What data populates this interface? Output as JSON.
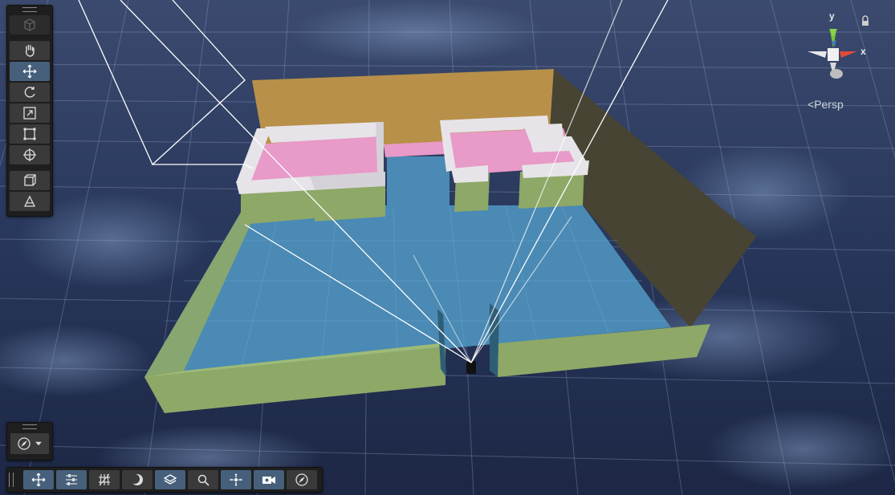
{
  "scene": {
    "projection_label": "Persp",
    "axis_y_label": "y",
    "axis_x_label": "x",
    "colors": {
      "floor": "#4a8ab4",
      "outer_wall": "#8ea868",
      "back_wall": "#b8904a",
      "right_wall": "#474433",
      "room_floor": "#e89ac8",
      "room_wall_top": "#e6e4e8"
    }
  },
  "left_toolbar": {
    "tools": [
      {
        "name": "view-tool-button",
        "icon": "hand-icon",
        "active": false
      },
      {
        "name": "move-tool-button",
        "icon": "move-icon",
        "active": true
      },
      {
        "name": "rotate-tool-button",
        "icon": "rotate-icon",
        "active": false
      },
      {
        "name": "scale-tool-button",
        "icon": "scale-icon",
        "active": false
      },
      {
        "name": "rect-tool-button",
        "icon": "rect-icon",
        "active": false
      },
      {
        "name": "transform-tool-button",
        "icon": "transform-icon",
        "active": false
      }
    ]
  },
  "bottom_toolbar": {
    "buttons": [
      {
        "name": "move-overlay-button",
        "icon": "move-icon",
        "active": true
      },
      {
        "name": "inspector-overlay-button",
        "icon": "sliders-icon",
        "active": true
      },
      {
        "name": "grid-overlay-button",
        "icon": "grid-icon",
        "active": false
      },
      {
        "name": "lighting-overlay-button",
        "icon": "moon-icon",
        "active": false
      },
      {
        "name": "layers-overlay-button",
        "icon": "layers-icon",
        "active": true
      },
      {
        "name": "search-overlay-button",
        "icon": "search-icon",
        "active": false
      },
      {
        "name": "navigation-overlay-button",
        "icon": "nav-icon",
        "active": true
      },
      {
        "name": "camera-overlay-button",
        "icon": "camera-icon",
        "active": true
      },
      {
        "name": "compass-overlay-button",
        "icon": "compass-icon",
        "active": false
      }
    ]
  }
}
